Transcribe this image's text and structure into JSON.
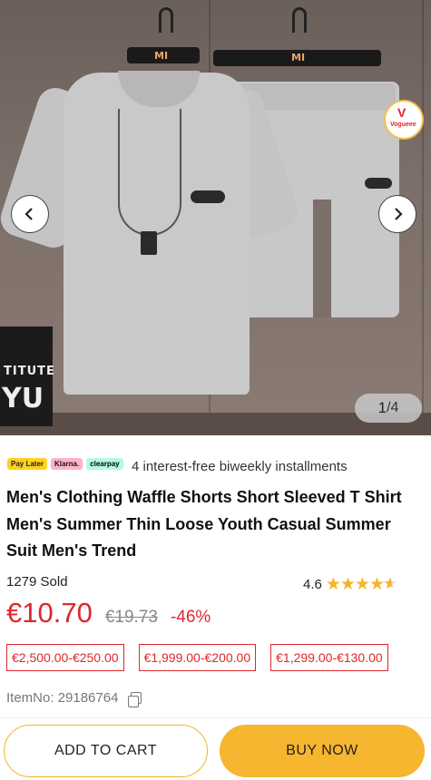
{
  "gallery": {
    "current": "1",
    "total": "/4",
    "prev_icon": "chevron-left-icon",
    "next_icon": "chevron-right-icon",
    "hanger_logo_1": "MI",
    "hanger_logo_2": "MI",
    "sign_text_1": "TITUTE",
    "sign_text_2": "YU",
    "badge_mark": "V",
    "badge_text": "Vogueee"
  },
  "payment": {
    "providers": [
      "Pay Later",
      "Klarna.",
      "clearpay"
    ],
    "text": "4 interest-free biweekly installments"
  },
  "product": {
    "title": "Men's Clothing Waffle Shorts Short Sleeved T Shirt Men's Summer Thin Loose Youth Casual Summer Suit Men's Trend",
    "sold": "1279 Sold",
    "rating": "4.6",
    "rating_stars": "★★★★",
    "price": "€10.70",
    "old_price": "€19.73",
    "discount": "-46%",
    "coupons": [
      "€2,500.00-€250.00",
      "€1,999.00-€200.00",
      "€1,299.00-€130.00"
    ],
    "item_no": "ItemNo: 29186764"
  },
  "actions": {
    "add_to_cart": "ADD TO CART",
    "buy_now": "BUY NOW"
  },
  "colors": {
    "accent": "#f6b62f",
    "price_red": "#e0262d"
  }
}
